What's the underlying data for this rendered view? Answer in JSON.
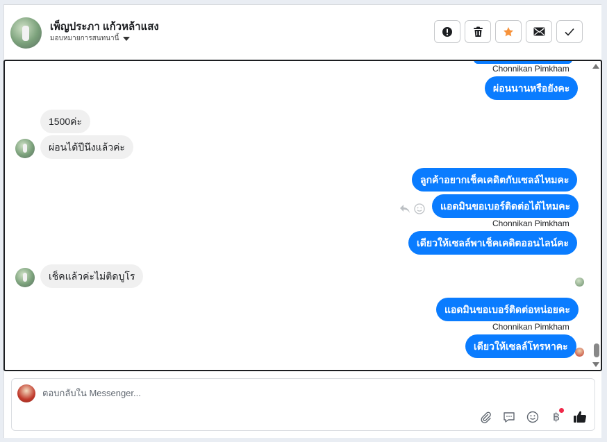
{
  "header": {
    "contact_name": "เพ็ญประภา แก้วหล้าแสง",
    "assign_label": "มอบหมายการสนทนานี้",
    "actions": [
      {
        "icon": "alert-icon",
        "name": "mark-spam-button"
      },
      {
        "icon": "trash-icon",
        "name": "delete-button"
      },
      {
        "icon": "star-icon",
        "name": "star-button"
      },
      {
        "icon": "envelope-icon",
        "name": "mark-unread-button"
      },
      {
        "icon": "check-icon",
        "name": "mark-done-button"
      }
    ]
  },
  "thread": {
    "messages": [
      {
        "dir": "out",
        "sender": "Chonnikan Pimkham",
        "text": "ผ่อนนานหรือยังคะ"
      },
      {
        "dir": "in",
        "text": "1500ค่ะ"
      },
      {
        "dir": "in",
        "text": "ผ่อนได้ปีนึงแล้วค่ะ"
      },
      {
        "dir": "out",
        "text": "ลูกค้าอยากเช็คเคดิตกับเซลล์ไหมคะ"
      },
      {
        "dir": "out",
        "text": "แอดมินขอเบอร์ติดต่อได้ไหมคะ"
      },
      {
        "dir": "out",
        "sender": "Chonnikan Pimkham",
        "text": "เดียวให้เซลล์พาเช็คเคดิตออนไลน์คะ"
      },
      {
        "dir": "in",
        "text": "เช็คแล้วค่ะไม่ติดบูโร"
      },
      {
        "dir": "out",
        "text": "แอดมินขอเบอร์ติดต่อหน่อยคะ"
      },
      {
        "dir": "out",
        "sender": "Chonnikan Pimkham",
        "text": "เดียวให้เซลล์โทรหาคะ"
      }
    ]
  },
  "composer": {
    "placeholder": "ตอบกลับใน Messenger...",
    "tools": [
      "paperclip-icon",
      "saved-reply-icon",
      "emoji-icon",
      "baht-icon",
      "thumbs-up-icon"
    ],
    "baht_symbol": "฿"
  },
  "colors": {
    "outgoing_bubble": "#0a7cff",
    "incoming_bubble": "#f0f0f0",
    "star": "#f7923a"
  }
}
